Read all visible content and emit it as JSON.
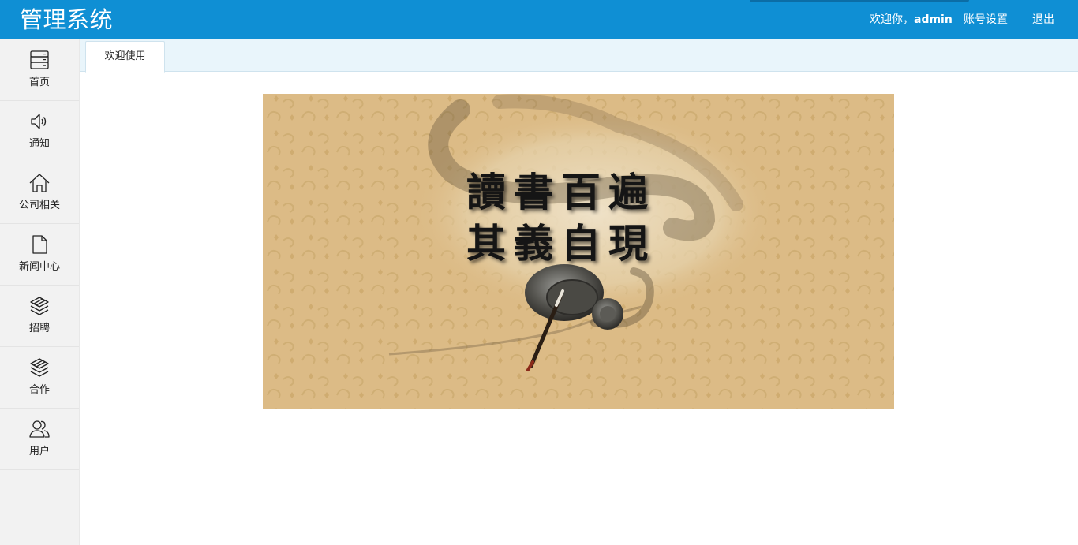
{
  "header": {
    "title": "管理系统",
    "welcome_prefix": "欢迎你，",
    "username": "admin",
    "account_settings": "账号设置",
    "logout": "退出"
  },
  "sidebar": {
    "items": [
      {
        "label": "首页",
        "icon": "server-icon"
      },
      {
        "label": "通知",
        "icon": "speaker-icon"
      },
      {
        "label": "公司相关",
        "icon": "home-icon"
      },
      {
        "label": "新闻中心",
        "icon": "document-icon"
      },
      {
        "label": "招聘",
        "icon": "layers-icon"
      },
      {
        "label": "合作",
        "icon": "layers-icon"
      },
      {
        "label": "用户",
        "icon": "users-icon"
      }
    ]
  },
  "tabs": [
    {
      "label": "欢迎使用",
      "active": true
    }
  ],
  "banner": {
    "line1": "讀書百遍",
    "line2": "其義自現"
  },
  "colors": {
    "header_bg": "#0f8fd4",
    "sidebar_bg": "#f2f2f2",
    "tabbar_bg": "#e9f5fb",
    "banner_bg": "#dfbe8a"
  }
}
